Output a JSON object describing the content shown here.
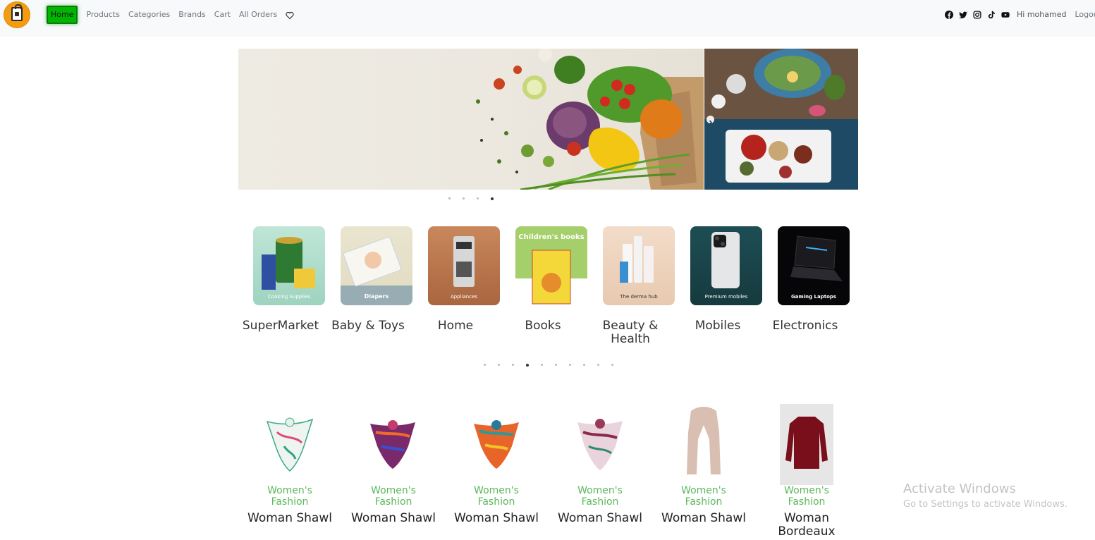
{
  "navbar": {
    "links": [
      "Home",
      "Products",
      "Categories",
      "Brands",
      "Cart",
      "All Orders"
    ],
    "active_link": "Home",
    "social_icons": [
      "facebook-icon",
      "twitter-icon",
      "instagram-icon",
      "tiktok-icon",
      "youtube-icon"
    ],
    "greeting": "Hi mohamed",
    "logout": "Logout"
  },
  "hero": {
    "slide_count": 4,
    "active_slide": 4
  },
  "categories": {
    "items": [
      {
        "name": "SuperMarket",
        "caption": "Cooking Supplies"
      },
      {
        "name": "Baby & Toys",
        "caption": "Diapers"
      },
      {
        "name": "Home",
        "caption": "Appliances"
      },
      {
        "name": "Books",
        "caption": "Children's books"
      },
      {
        "name": "Beauty & Health",
        "caption": "The derma hub"
      },
      {
        "name": "Mobiles",
        "caption": "Premium mobiles"
      },
      {
        "name": "Electronics",
        "caption": "Gaming Laptops"
      }
    ],
    "page_count": 10,
    "active_page": 4
  },
  "products": [
    {
      "category": "Women's Fashion",
      "title": "Woman Shawl"
    },
    {
      "category": "Women's Fashion",
      "title": "Woman Shawl"
    },
    {
      "category": "Women's Fashion",
      "title": "Woman Shawl"
    },
    {
      "category": "Women's Fashion",
      "title": "Woman Shawl"
    },
    {
      "category": "Women's Fashion",
      "title": "Woman Shawl"
    },
    {
      "category": "Women's Fashion",
      "title": "Woman Bordeaux"
    }
  ],
  "watermark": {
    "title": "Activate Windows",
    "subtitle": "Go to Settings to activate Windows."
  },
  "colors": {
    "accent": "#02b502",
    "product_category": "#5cb85c",
    "logo": "#f39c12"
  }
}
